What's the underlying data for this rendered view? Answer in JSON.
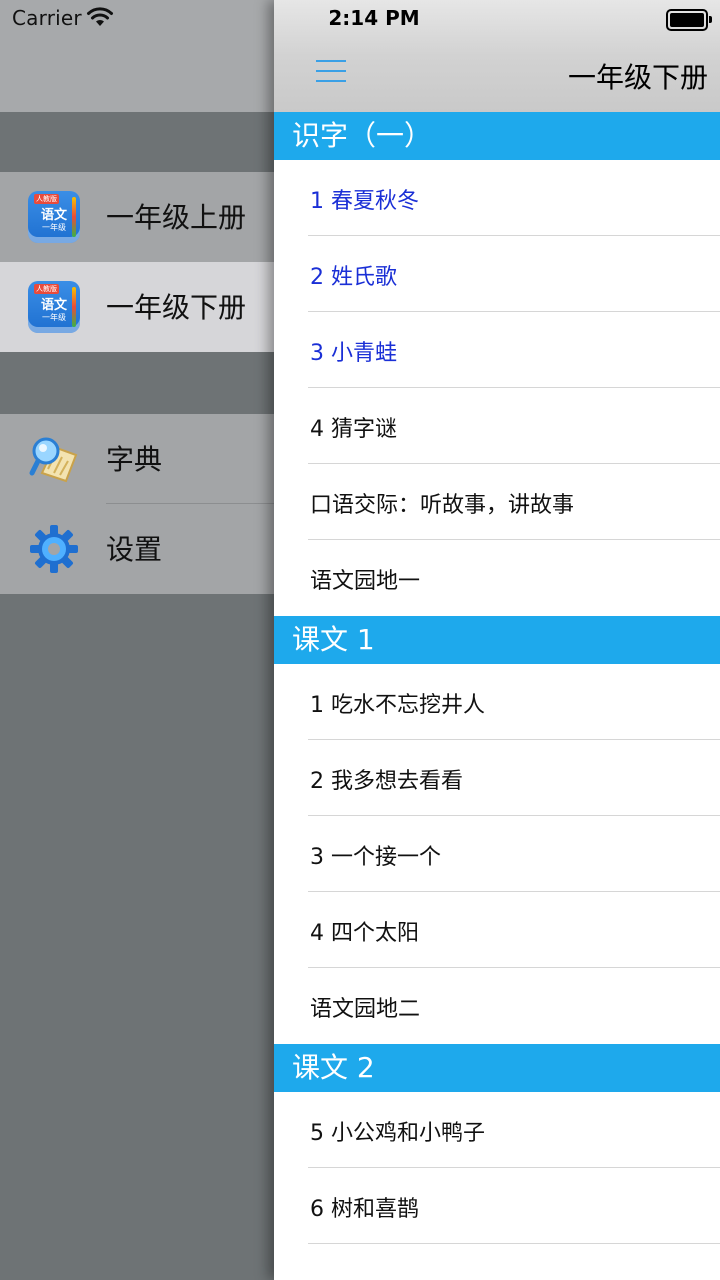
{
  "status_bar": {
    "carrier": "Carrier",
    "time": "2:14 PM"
  },
  "drawer": {
    "books": [
      {
        "label": "一年级上册",
        "icon_badge": "人教版",
        "icon_title": "语文",
        "icon_subtitle": "一年级",
        "selected": false
      },
      {
        "label": "一年级下册",
        "icon_badge": "人教版",
        "icon_title": "语文",
        "icon_subtitle": "一年级",
        "selected": true
      }
    ],
    "tools": [
      {
        "label": "字典",
        "icon": "dictionary-icon"
      },
      {
        "label": "设置",
        "icon": "gear-icon"
      }
    ]
  },
  "panel": {
    "title": "一年级下册",
    "menu_icon": "hamburger-icon",
    "sections": [
      {
        "header": "识字（一）",
        "rows": [
          {
            "text": "1 春夏秋冬",
            "read": true
          },
          {
            "text": "2 姓氏歌",
            "read": true
          },
          {
            "text": "3 小青蛙",
            "read": true
          },
          {
            "text": "4 猜字谜",
            "read": false
          },
          {
            "text": "口语交际：听故事，讲故事",
            "read": false
          },
          {
            "text": "语文园地一",
            "read": false
          }
        ]
      },
      {
        "header": "课文 1",
        "rows": [
          {
            "text": "1 吃水不忘挖井人",
            "read": false
          },
          {
            "text": "2 我多想去看看",
            "read": false
          },
          {
            "text": "3 一个接一个",
            "read": false
          },
          {
            "text": "4 四个太阳",
            "read": false
          },
          {
            "text": "语文园地二",
            "read": false
          }
        ]
      },
      {
        "header": "课文 2",
        "rows": [
          {
            "text": "5 小公鸡和小鸭子",
            "read": false
          },
          {
            "text": "6 树和喜鹊",
            "read": false
          }
        ]
      }
    ]
  },
  "colors": {
    "section_header": "#1ea9ec",
    "read_text": "#1a2fd6",
    "accent_icon": "#3aa0e6"
  }
}
